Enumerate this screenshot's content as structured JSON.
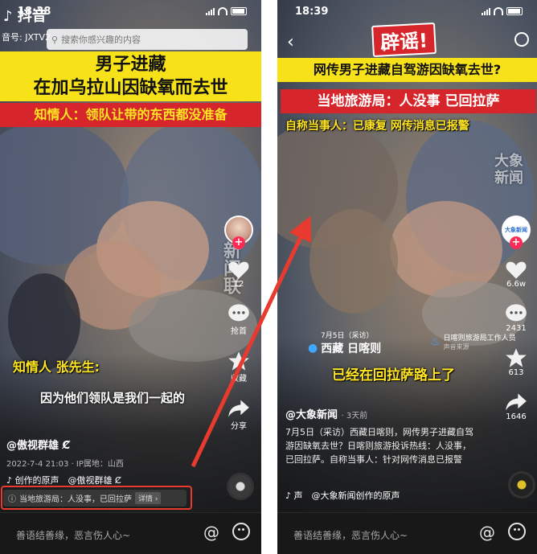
{
  "left": {
    "status": {
      "time": "18:38"
    },
    "app_name": "抖音",
    "account_prefix": "音号: JXTV2",
    "search_placeholder": "搜索你感兴趣的内容",
    "title_line1": "男子进藏",
    "title_line2": "在加乌拉山因缺氧而去世",
    "subtitle": "知情人：领队让带的东西都没准备",
    "overlay_text": "新闻联",
    "caption_speaker": "知情人 张先生:",
    "caption_line": "因为他们领队是我们一起的",
    "actions": [
      {
        "name": "like",
        "count": "12"
      },
      {
        "name": "comment",
        "count": "抢首"
      },
      {
        "name": "favorite",
        "count": "收藏"
      },
      {
        "name": "share",
        "count": "分享"
      }
    ],
    "author": "@傲视群雄",
    "author_badge": "Ȼ",
    "meta": "2022-7-4 21:03 · IP属地：山西",
    "music": "创作的原声　@傲视群雄 Ȼ",
    "notice_text": "当地旅游局：人没事，已回拉萨",
    "notice_detail": "详情 ›",
    "comment_placeholder": "善语结善缘，恶言伤人心~"
  },
  "right": {
    "status": {
      "time": "18:39"
    },
    "stamp": "辟谣!",
    "title": "网传男子进藏自驾游因缺氧去世?",
    "banner_red": "当地旅游局：人没事 已回拉萨",
    "subtitle": "自称当事人：已康复 网传消息已报警",
    "watermark": "大象新闻",
    "location_date": "7月5日（采访）",
    "location_name": "西藏 日喀则",
    "source_text": "日喀则旅游局工作人员",
    "source_sub": "声音来源",
    "caption": "已经在回拉萨路上了",
    "avatar_label": "大象新闻",
    "actions": [
      {
        "name": "like",
        "count": "6.6w"
      },
      {
        "name": "comment",
        "count": "2431"
      },
      {
        "name": "favorite",
        "count": "613"
      },
      {
        "name": "share",
        "count": "1646"
      }
    ],
    "author": "@大象新闻",
    "time_ago": "· 3天前",
    "description": "7月5日（采访）西藏日喀则，网传男子进藏自驾游因缺氧去世？日喀则旅游投诉热线：人没事，已回拉萨。自称当事人：针对网传消息已报警",
    "music": "声　@大象新闻创作的原声",
    "comment_placeholder": "善语结善缘，恶言伤人心~"
  },
  "colors": {
    "banner_yellow": "#f7e21a",
    "banner_red": "#d6262b",
    "arrow_red": "#e83a2e",
    "like_pink": "#fe2c55"
  }
}
